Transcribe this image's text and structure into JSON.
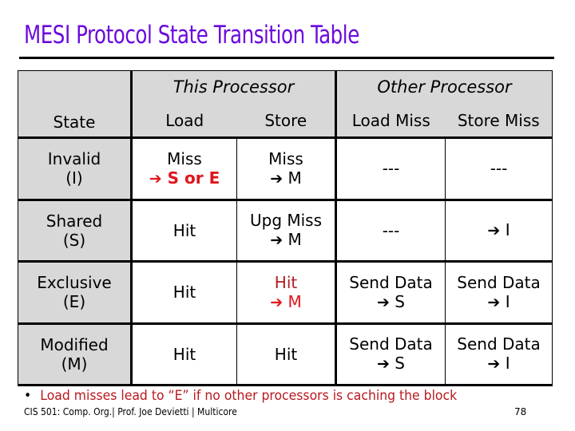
{
  "slide": {
    "title": "MESI Protocol State Transition Table",
    "colors": {
      "title": "#6a0adc",
      "highlight": "#e0141c",
      "note": "#b8191e",
      "header_bg": "#d8d8d8"
    }
  },
  "table": {
    "group_headers": {
      "this_processor": "This Processor",
      "other_processor": "Other Processor"
    },
    "columns": [
      "State",
      "Load",
      "Store",
      "Load Miss",
      "Store Miss"
    ],
    "arrow_icon": "➔",
    "rows": [
      {
        "state": "Invalid",
        "abbr": "(I)",
        "load": {
          "line1": "Miss",
          "line2": "S or E"
        },
        "store": {
          "line1": "Miss",
          "line2": "M"
        },
        "load_miss": {
          "line1": "---"
        },
        "store_miss": {
          "line1": "---"
        }
      },
      {
        "state": "Shared",
        "abbr": "(S)",
        "load": {
          "line1": "Hit"
        },
        "store": {
          "line1": "Upg Miss",
          "line2": "M"
        },
        "load_miss": {
          "line1": "---"
        },
        "store_miss": {
          "line2": "I"
        }
      },
      {
        "state": "Exclusive",
        "abbr": "(E)",
        "load": {
          "line1": "Hit"
        },
        "store": {
          "line1": "Hit",
          "line2": "M"
        },
        "load_miss": {
          "line1": "Send Data",
          "line2": "S"
        },
        "store_miss": {
          "line1": "Send Data",
          "line2": "I"
        }
      },
      {
        "state": "Modified",
        "abbr": "(M)",
        "load": {
          "line1": "Hit"
        },
        "store": {
          "line1": "Hit"
        },
        "load_miss": {
          "line1": "Send Data",
          "line2": "S"
        },
        "store_miss": {
          "line1": "Send Data",
          "line2": "I"
        }
      }
    ]
  },
  "note": {
    "bullet": "•",
    "text": "Load misses lead to “E” if no other processors is caching the block"
  },
  "footer": {
    "text": "CIS 501: Comp. Org.| Prof. Joe Devietti  |  Multicore",
    "page_number": "78"
  }
}
